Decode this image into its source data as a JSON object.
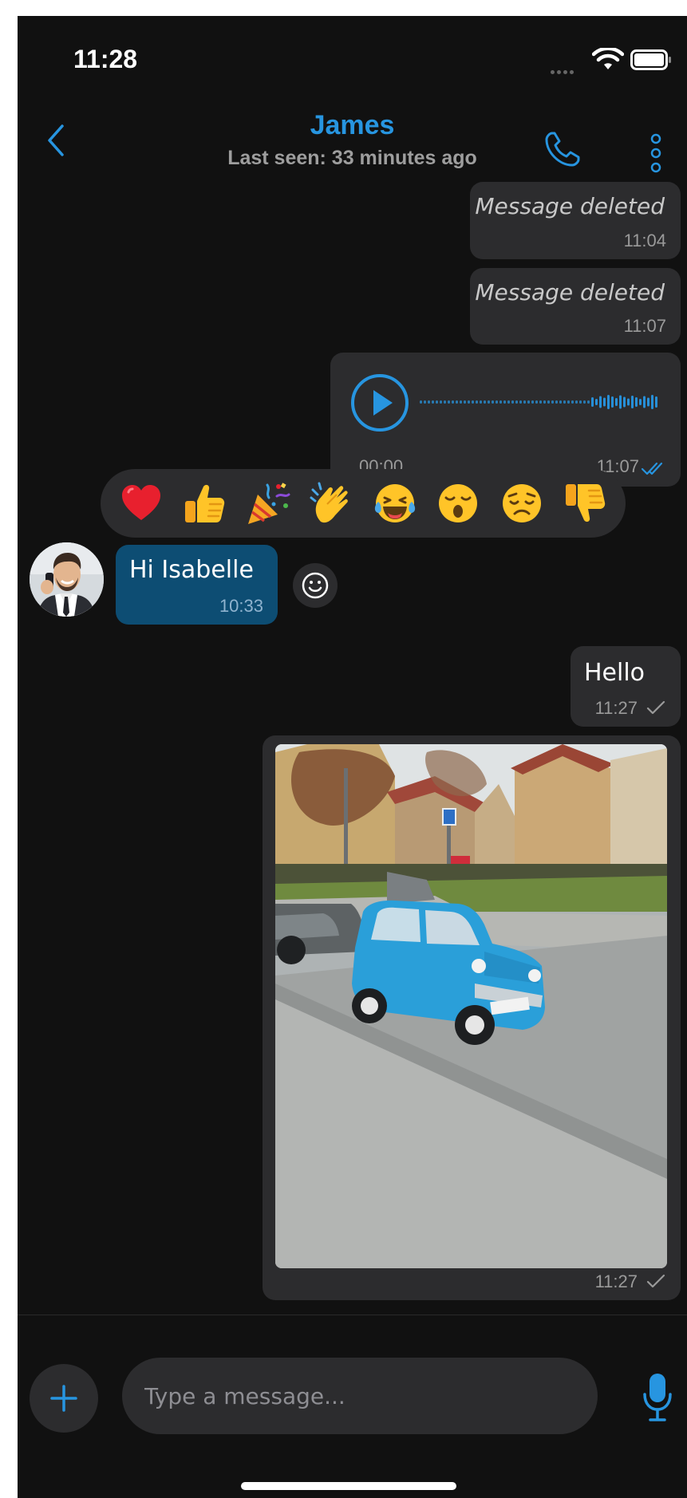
{
  "status_bar": {
    "time": "11:28"
  },
  "header": {
    "contact_name": "James",
    "last_seen": "Last seen: 33 minutes ago"
  },
  "messages": [
    {
      "direction": "outgoing",
      "type": "deleted",
      "text": "Message deleted",
      "time": "11:04"
    },
    {
      "direction": "outgoing",
      "type": "deleted",
      "text": "Message deleted",
      "time": "11:07"
    },
    {
      "direction": "outgoing",
      "type": "voice",
      "duration": "00:00",
      "time": "11:07",
      "status": "read"
    },
    {
      "direction": "incoming",
      "type": "text",
      "text": "Hi Isabelle",
      "time": "10:33"
    },
    {
      "direction": "outgoing",
      "type": "text",
      "text": "Hello",
      "time": "11:27",
      "status": "sent"
    },
    {
      "direction": "outgoing",
      "type": "image",
      "time": "11:27",
      "status": "sent"
    }
  ],
  "reactions": [
    "❤️",
    "👍",
    "🎉",
    "👏",
    "😂",
    "😮",
    "😞",
    "👎"
  ],
  "input": {
    "placeholder": "Type a message..."
  },
  "colors": {
    "accent": "#2795e0",
    "background": "#111111",
    "bubble": "#2c2c2e",
    "incoming_bubble": "#0d4d73"
  }
}
